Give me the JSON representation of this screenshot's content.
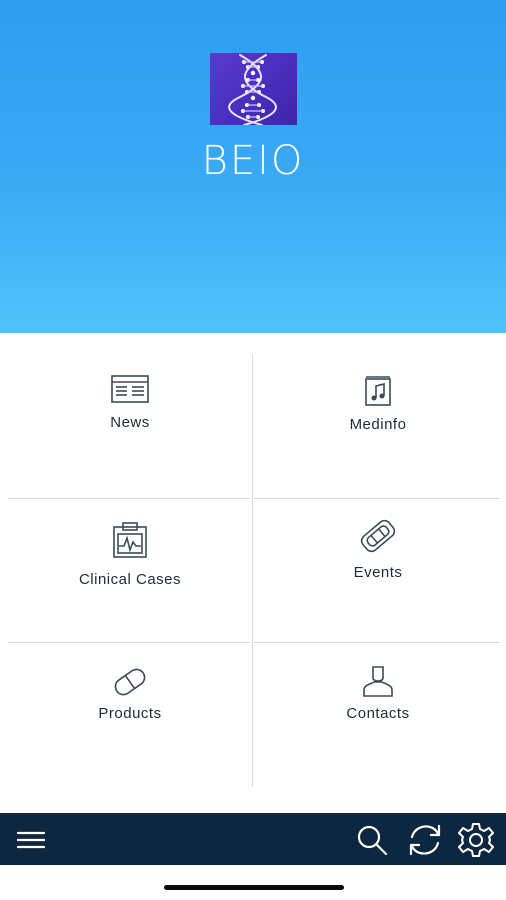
{
  "app": {
    "name": "BEIO"
  },
  "grid": {
    "items": [
      {
        "label": "News",
        "icon": "newspaper-icon"
      },
      {
        "label": "Medinfo",
        "icon": "music-document-icon"
      },
      {
        "label": "Clinical Cases",
        "icon": "clipboard-chart-icon"
      },
      {
        "label": "Events",
        "icon": "ticket-icon"
      },
      {
        "label": "Products",
        "icon": "pill-icon"
      },
      {
        "label": "Contacts",
        "icon": "person-icon"
      }
    ]
  },
  "bottom_bar": {
    "icons": [
      "hamburger-menu-icon",
      "search-icon",
      "refresh-icon",
      "gear-icon"
    ]
  },
  "colors": {
    "header_top": "#2e9df0",
    "header_bottom": "#4fc3fb",
    "bottom_bar": "#0e2740",
    "logo_bg": "#4b2fc0"
  }
}
